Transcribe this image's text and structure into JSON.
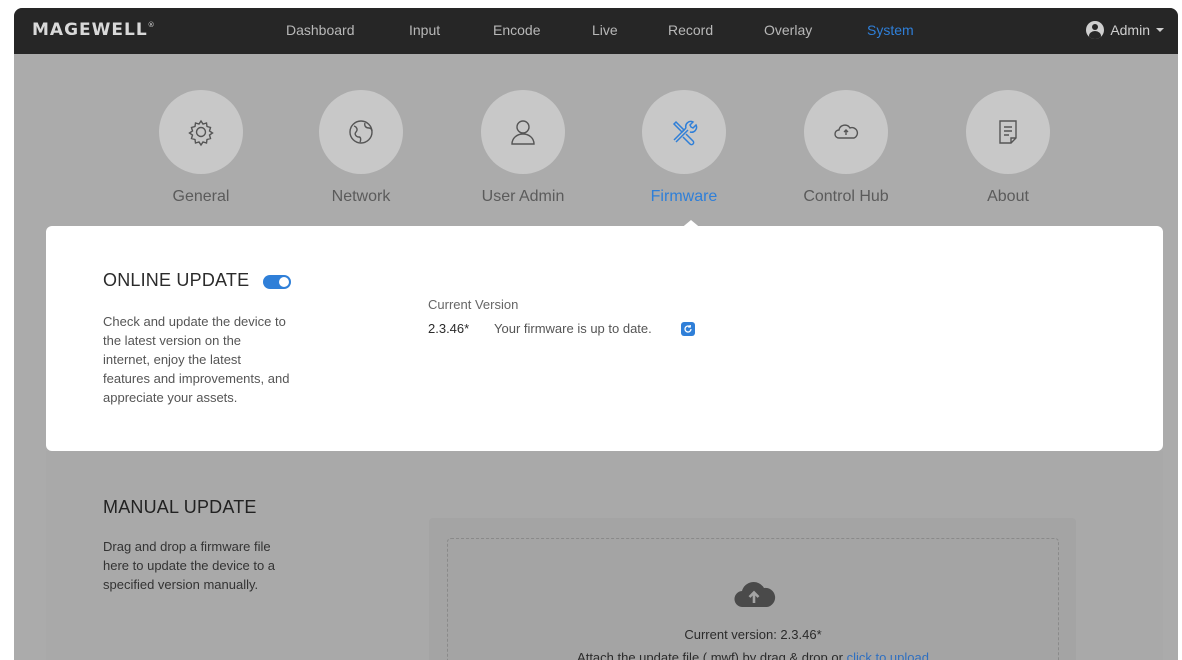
{
  "brand": {
    "logo": "MAGEWELL",
    "mark": "®"
  },
  "nav": {
    "items": [
      {
        "label": "Dashboard"
      },
      {
        "label": "Input"
      },
      {
        "label": "Encode"
      },
      {
        "label": "Live"
      },
      {
        "label": "Record"
      },
      {
        "label": "Overlay"
      },
      {
        "label": "System",
        "active": true
      }
    ],
    "user": "Admin"
  },
  "categories": [
    {
      "label": "General",
      "icon": "gear-icon"
    },
    {
      "label": "Network",
      "icon": "globe-icon"
    },
    {
      "label": "User Admin",
      "icon": "user-icon"
    },
    {
      "label": "Firmware",
      "icon": "tools-icon",
      "active": true
    },
    {
      "label": "Control Hub",
      "icon": "cloud-icon"
    },
    {
      "label": "About",
      "icon": "document-icon"
    }
  ],
  "online_update": {
    "title": "ONLINE UPDATE",
    "enabled": true,
    "description_lines": [
      "Check and update the device to",
      "the latest version on the",
      "internet, enjoy the latest",
      "features and improvements, and",
      "appreciate your assets."
    ],
    "current_version_label": "Current Version",
    "current_version": "2.3.46*",
    "status": "Your firmware is up to date."
  },
  "manual_update": {
    "title": "MANUAL UPDATE",
    "description_lines": [
      "Drag and drop a firmware file",
      "here to update the device to a",
      "specified version manually."
    ],
    "drop_current_version": "Current version: 2.3.46*",
    "drop_hint": "Attach the update file (.mwf) by drag & drop or",
    "drop_link": "click to upload"
  },
  "colors": {
    "accent": "#2f7fd8",
    "topbar": "#262626",
    "overlay": "#ababab"
  }
}
